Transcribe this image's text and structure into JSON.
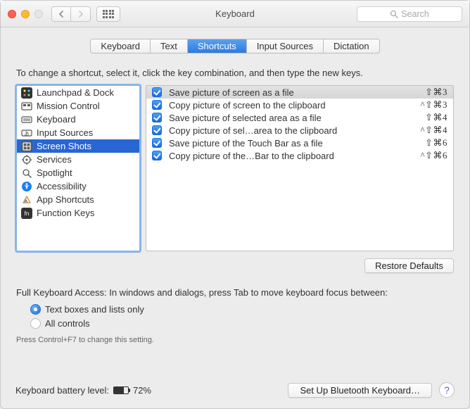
{
  "window": {
    "title": "Keyboard"
  },
  "search": {
    "placeholder": "Search"
  },
  "tabs": [
    "Keyboard",
    "Text",
    "Shortcuts",
    "Input Sources",
    "Dictation"
  ],
  "tabs_active_index": 2,
  "instruction": "To change a shortcut, select it, click the key combination, and then type the new keys.",
  "categories": [
    {
      "label": "Launchpad & Dock",
      "icon": "launchpad"
    },
    {
      "label": "Mission Control",
      "icon": "mission"
    },
    {
      "label": "Keyboard",
      "icon": "keyboard"
    },
    {
      "label": "Input Sources",
      "icon": "input"
    },
    {
      "label": "Screen Shots",
      "icon": "screenshots"
    },
    {
      "label": "Services",
      "icon": "services"
    },
    {
      "label": "Spotlight",
      "icon": "spotlight"
    },
    {
      "label": "Accessibility",
      "icon": "accessibility"
    },
    {
      "label": "App Shortcuts",
      "icon": "apps"
    },
    {
      "label": "Function Keys",
      "icon": "fn"
    }
  ],
  "categories_selected_index": 4,
  "shortcuts": [
    {
      "enabled": true,
      "label": "Save picture of screen as a file",
      "keys": "⇧⌘3"
    },
    {
      "enabled": true,
      "label": "Copy picture of screen to the clipboard",
      "keys": "^⇧⌘3"
    },
    {
      "enabled": true,
      "label": "Save picture of selected area as a file",
      "keys": "⇧⌘4"
    },
    {
      "enabled": true,
      "label": "Copy picture of sel…area to the clipboard",
      "keys": "^⇧⌘4"
    },
    {
      "enabled": true,
      "label": "Save picture of the Touch Bar as a file",
      "keys": "⇧⌘6"
    },
    {
      "enabled": true,
      "label": "Copy picture of the…Bar to the clipboard",
      "keys": "^⇧⌘6"
    }
  ],
  "shortcuts_selected_index": 0,
  "restore_button": "Restore Defaults",
  "fka": {
    "intro": "Full Keyboard Access: In windows and dialogs, press Tab to move keyboard focus between:",
    "options": [
      "Text boxes and lists only",
      "All controls"
    ],
    "selected_index": 0,
    "help": "Press Control+F7 to change this setting."
  },
  "battery": {
    "label": "Keyboard battery level:",
    "percent_text": "72%",
    "percent": 72
  },
  "bluetooth_button": "Set Up Bluetooth Keyboard…"
}
